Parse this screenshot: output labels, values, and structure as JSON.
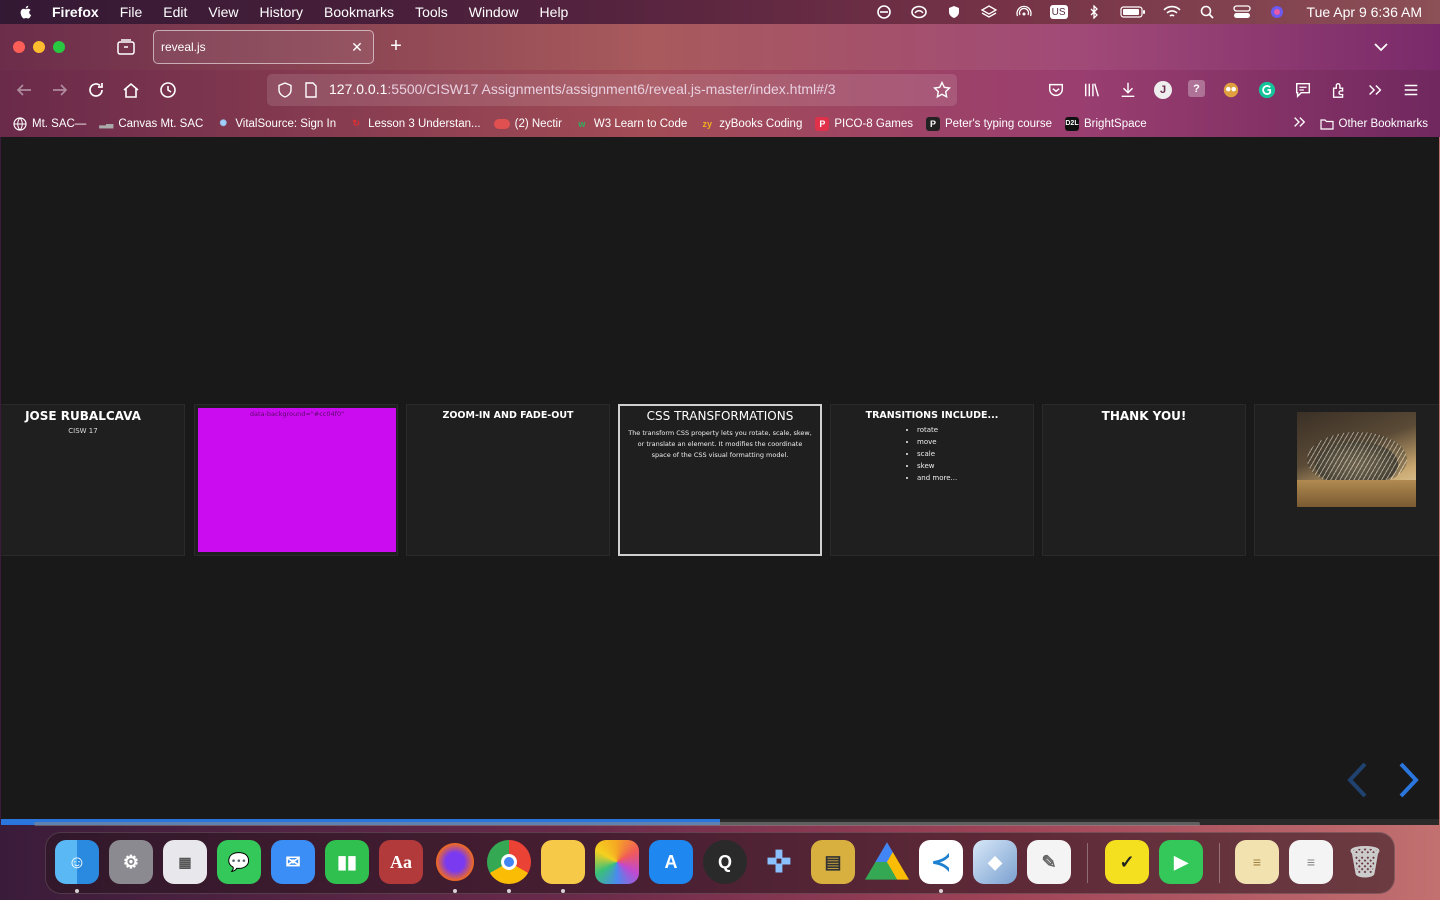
{
  "menubar": {
    "app_name": "Firefox",
    "items": [
      "File",
      "Edit",
      "View",
      "History",
      "Bookmarks",
      "Tools",
      "Window",
      "Help"
    ],
    "clock": "Tue Apr 9  6:36 AM",
    "input_source": "US"
  },
  "browser": {
    "tab_title": "reveal.js",
    "url_host": "127.0.0.1",
    "url_rest": ":5500/CISW17 Assignments/assignment6/reveal.js-master/index.html#/3"
  },
  "bookmarks": {
    "items": [
      {
        "label": "Mt. SAC—",
        "icon": "globe-icon"
      },
      {
        "label": "Canvas Mt. SAC",
        "icon": "canvas-icon"
      },
      {
        "label": "VitalSource: Sign In",
        "icon": "vitalsource-icon"
      },
      {
        "label": "Lesson 3 Understan...",
        "icon": "lesson-icon"
      },
      {
        "label": "(2) Nectir",
        "icon": "nectir-icon"
      },
      {
        "label": "W3 Learn to Code",
        "icon": "w3-icon"
      },
      {
        "label": "zyBooks Coding",
        "icon": "zybooks-icon"
      },
      {
        "label": "PICO-8 Games",
        "icon": "pico8-icon"
      },
      {
        "label": "Peter's typing course",
        "icon": "p-icon"
      },
      {
        "label": "BrightSpace",
        "icon": "d2l-icon"
      }
    ],
    "other_label": "Other Bookmarks"
  },
  "slides": {
    "s1_title": "JOSE RUBALCAVA",
    "s1_sub": "CISW 17",
    "s2_label": "data-background=\"#cc04f0\"",
    "s2_color": "#cc0cf0",
    "s3_title": "ZOOM-IN AND FADE-OUT",
    "s4_title": "CSS TRANSFORMATIONS",
    "s4_body": "The transform CSS property lets you rotate, scale, skew, or translate an element. It modifies the coordinate space of the CSS visual formatting model.",
    "s5_title": "TRANSITIONS INCLUDE...",
    "s5_items": [
      "rotate",
      "move",
      "scale",
      "skew",
      "and more..."
    ],
    "s6_title": "THANK YOU!",
    "s7_image": "porcupine-photo"
  },
  "presentation": {
    "progress": 0.5,
    "arrow_color": "#2a76dd"
  },
  "dock": {
    "apps": [
      "Finder",
      "System Settings",
      "Launchpad",
      "Messages",
      "Mail",
      "Numbers",
      "Dictionary",
      "Firefox",
      "Chrome",
      "Notes",
      "Photos",
      "App Store",
      "QuickTime Player",
      "Joystick",
      "Archive Utility",
      "Google Drive",
      "VS Code",
      "Monument",
      "TextEdit",
      "Todo",
      "FaceTime",
      "Document",
      "Document",
      "Trash"
    ]
  }
}
